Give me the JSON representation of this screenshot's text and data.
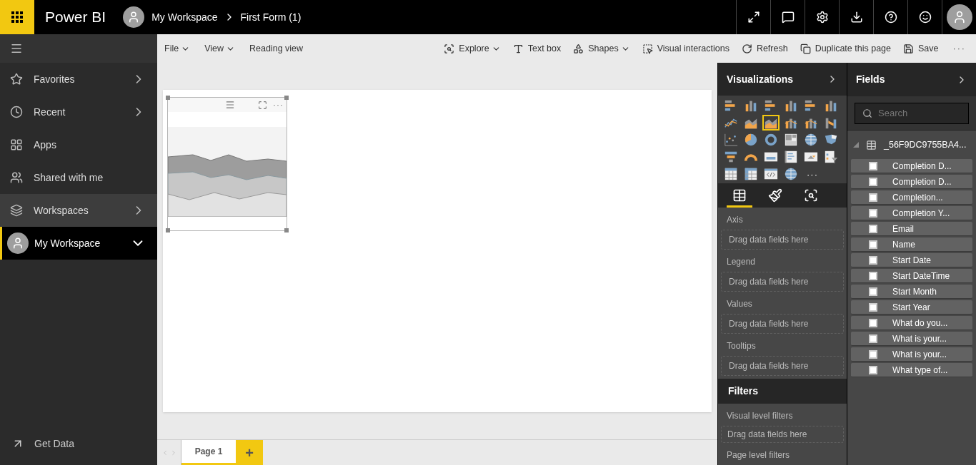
{
  "app": {
    "name": "Power BI",
    "breadcrumb": [
      "My Workspace",
      "First Form (1)"
    ]
  },
  "sidebar": {
    "items": [
      {
        "label": "Favorites",
        "kind": "chevron-right",
        "selected": false,
        "hovered": false
      },
      {
        "label": "Recent",
        "kind": "chevron-right",
        "selected": false,
        "hovered": false
      },
      {
        "label": "Apps",
        "kind": "plain",
        "selected": false,
        "hovered": false
      },
      {
        "label": "Shared with me",
        "kind": "plain",
        "selected": false,
        "hovered": false
      },
      {
        "label": "Workspaces",
        "kind": "chevron-right",
        "selected": false,
        "hovered": true
      },
      {
        "label": "My Workspace",
        "kind": "chevron-down",
        "selected": true,
        "hovered": false
      }
    ],
    "footer": "Get Data"
  },
  "toolbar": {
    "left": [
      {
        "label": "File",
        "dropdown": true
      },
      {
        "label": "View",
        "dropdown": true
      },
      {
        "label": "Reading view",
        "dropdown": false
      }
    ],
    "right": [
      {
        "label": "Explore",
        "dropdown": true
      },
      {
        "label": "Text box",
        "dropdown": false
      },
      {
        "label": "Shapes",
        "dropdown": true
      },
      {
        "label": "Visual interactions",
        "dropdown": false
      },
      {
        "label": "Refresh",
        "dropdown": false
      },
      {
        "label": "Duplicate this page",
        "dropdown": false
      },
      {
        "label": "Save",
        "dropdown": false
      }
    ],
    "more": "···"
  },
  "visualizations": {
    "title": "Visualizations",
    "more": "···",
    "icons": [
      {
        "selected": false
      },
      {
        "selected": false
      },
      {
        "selected": false
      },
      {
        "selected": false
      },
      {
        "selected": false
      },
      {
        "selected": false
      },
      {
        "selected": false
      },
      {
        "selected": false
      },
      {
        "selected": true
      },
      {
        "selected": false
      },
      {
        "selected": false
      },
      {
        "selected": false
      },
      {
        "selected": false
      },
      {
        "selected": false
      },
      {
        "selected": false
      },
      {
        "selected": false
      },
      {
        "selected": false
      },
      {
        "selected": false
      },
      {
        "selected": false
      },
      {
        "selected": false
      },
      {
        "selected": false
      },
      {
        "selected": false
      },
      {
        "selected": false
      },
      {
        "selected": false
      },
      {
        "selected": false
      },
      {
        "selected": false
      },
      {
        "selected": false
      },
      {
        "selected": false
      }
    ],
    "pane_tabs": [
      {
        "selected": true
      },
      {
        "selected": false
      },
      {
        "selected": false
      }
    ],
    "wells": [
      {
        "label": "Axis",
        "placeholder": "Drag data fields here"
      },
      {
        "label": "Legend",
        "placeholder": "Drag data fields here"
      },
      {
        "label": "Values",
        "placeholder": "Drag data fields here"
      },
      {
        "label": "Tooltips",
        "placeholder": "Drag data fields here"
      }
    ]
  },
  "filters": {
    "title": "Filters",
    "sections": [
      {
        "label": "Visual level filters",
        "placeholder": "Drag data fields here"
      },
      {
        "label": "Page level filters"
      }
    ]
  },
  "fields": {
    "title": "Fields",
    "search_placeholder": "Search",
    "table": {
      "name": "_56F9DC9755BA4...",
      "expanded": true,
      "children": [
        {
          "name": "Completion D...",
          "checked": false
        },
        {
          "name": "Completion D...",
          "checked": false
        },
        {
          "name": "Completion...",
          "checked": false
        },
        {
          "name": "Completion Y...",
          "checked": false
        },
        {
          "name": "Email",
          "checked": false
        },
        {
          "name": "Name",
          "checked": false
        },
        {
          "name": "Start Date",
          "checked": false
        },
        {
          "name": "Start DateTime",
          "checked": false
        },
        {
          "name": "Start Month",
          "checked": false
        },
        {
          "name": "Start Year",
          "checked": false
        },
        {
          "name": "What do you...",
          "checked": false
        },
        {
          "name": "What is your...",
          "checked": false
        },
        {
          "name": "What is your...",
          "checked": false
        },
        {
          "name": "What type of...",
          "checked": false
        }
      ]
    }
  },
  "visual": {
    "more": "···"
  },
  "pages": [
    {
      "label": "Page 1",
      "selected": true
    }
  ],
  "add_page": "+"
}
